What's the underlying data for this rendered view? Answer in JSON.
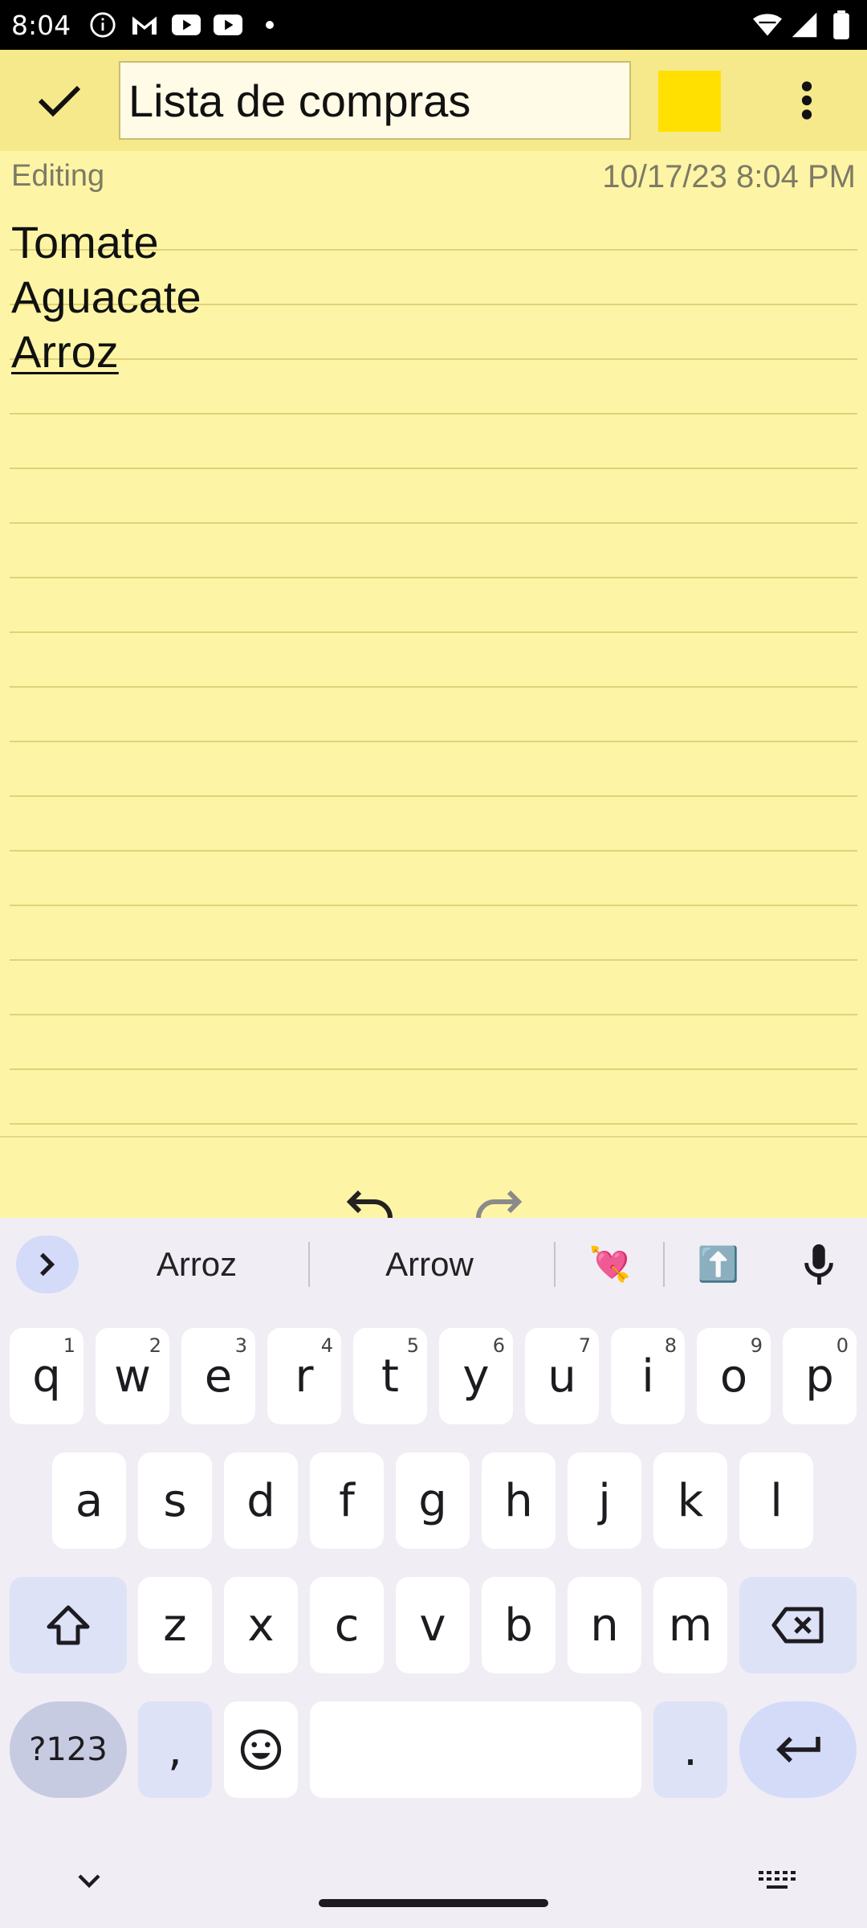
{
  "status_bar": {
    "time": "8:04",
    "left_icons": [
      "info-icon",
      "gmail-icon",
      "youtube-icon",
      "youtube-icon",
      "dot-icon"
    ],
    "right_icons": [
      "wifi-icon",
      "signal-icon",
      "battery-icon"
    ]
  },
  "toolbar": {
    "title_value": "Lista de compras",
    "note_color": "#ffe000",
    "icons": [
      "check-icon",
      "more-vert-icon"
    ]
  },
  "note": {
    "status": "Editing",
    "timestamp": "10/17/23 8:04 PM",
    "lines": [
      "Tomate",
      "Aguacate",
      "Arroz"
    ]
  },
  "edit_controls": {
    "icons": [
      "undo-icon",
      "redo-icon"
    ]
  },
  "keyboard": {
    "suggestions": [
      "Arroz",
      "Arrow",
      "💘",
      "⬆️"
    ],
    "row1": [
      {
        "key": "q",
        "hint": "1"
      },
      {
        "key": "w",
        "hint": "2"
      },
      {
        "key": "e",
        "hint": "3"
      },
      {
        "key": "r",
        "hint": "4"
      },
      {
        "key": "t",
        "hint": "5"
      },
      {
        "key": "y",
        "hint": "6"
      },
      {
        "key": "u",
        "hint": "7"
      },
      {
        "key": "i",
        "hint": "8"
      },
      {
        "key": "o",
        "hint": "9"
      },
      {
        "key": "p",
        "hint": "0"
      }
    ],
    "row2": [
      "a",
      "s",
      "d",
      "f",
      "g",
      "h",
      "j",
      "k",
      "l"
    ],
    "row3": [
      "z",
      "x",
      "c",
      "v",
      "b",
      "n",
      "m"
    ],
    "symbols_label": "?123",
    "comma": ",",
    "period": ".",
    "accent_color": "#d3dbf8"
  }
}
